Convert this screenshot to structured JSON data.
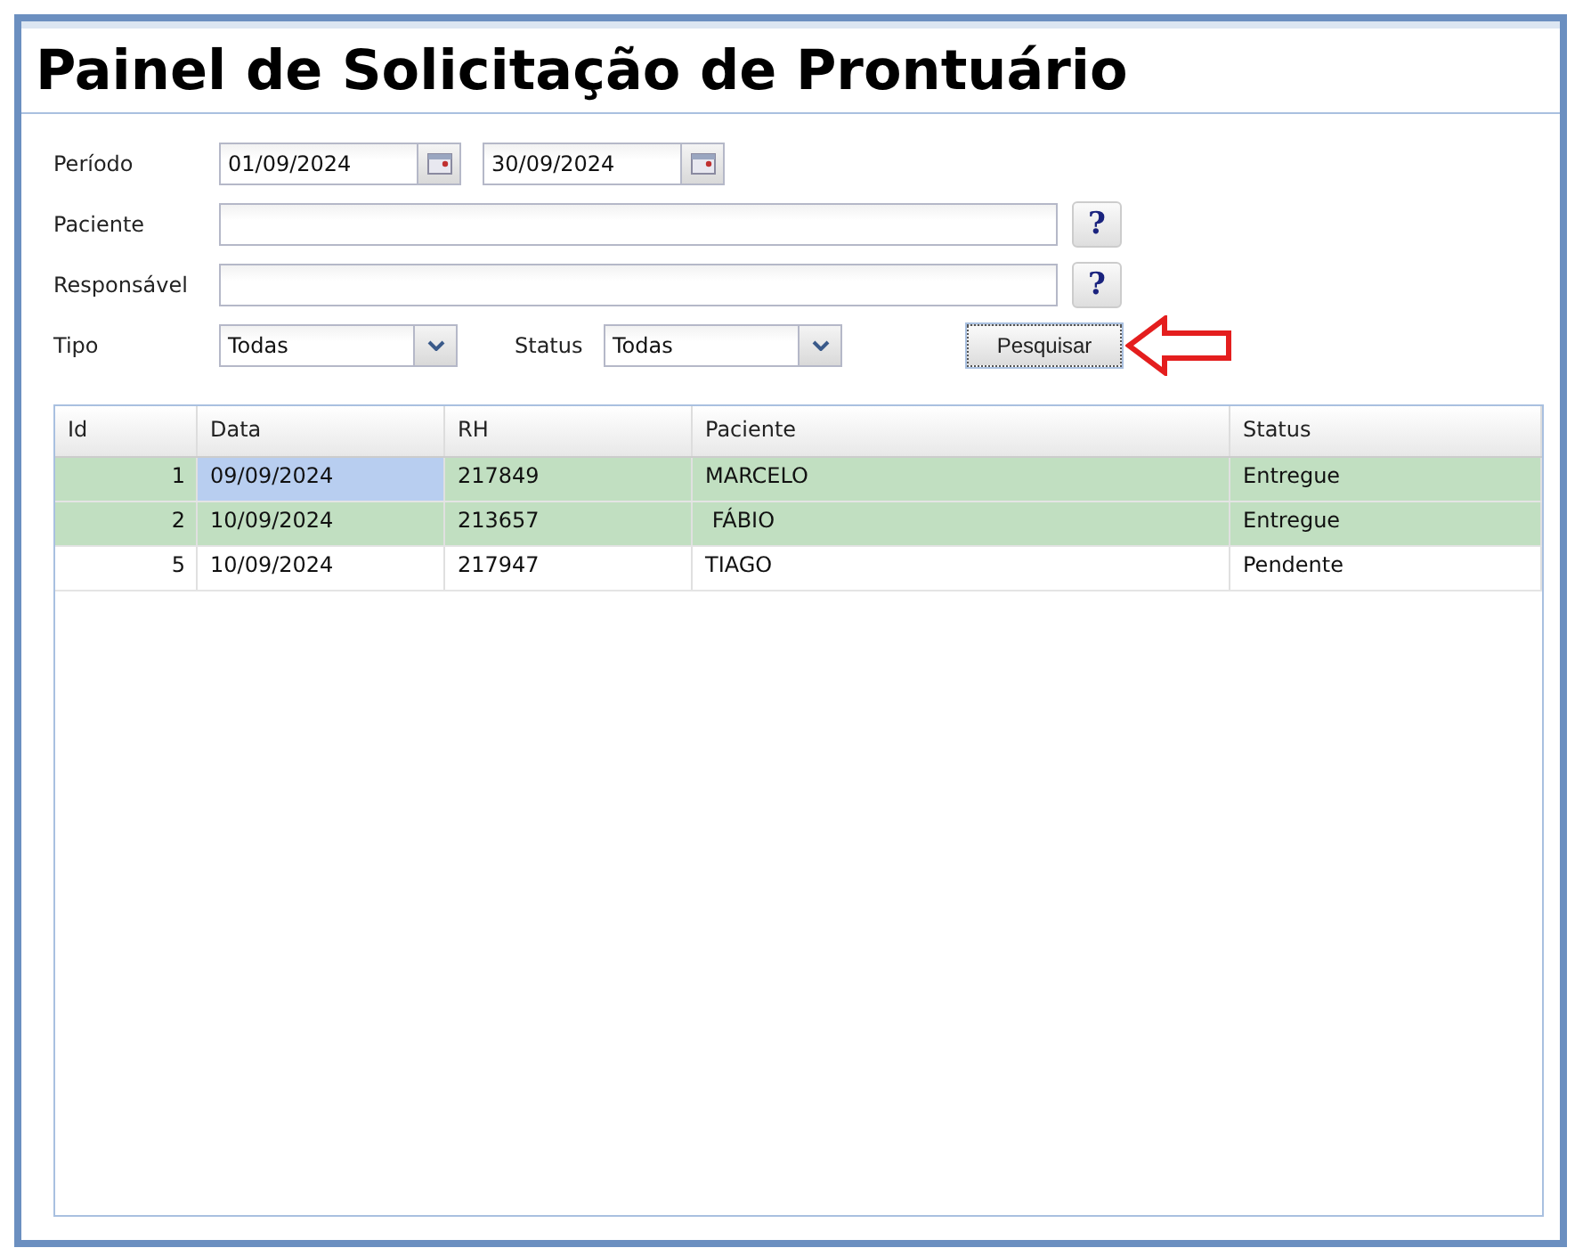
{
  "title": "Painel de Solicitação de Prontuário",
  "filters": {
    "period_label": "Período",
    "date_from": "01/09/2024",
    "date_to": "30/09/2024",
    "patient_label": "Paciente",
    "responsible_label": "Responsável",
    "help_buttons": [
      "?",
      "?"
    ],
    "type_label": "Tipo",
    "type_value": "Todas",
    "status_label": "Status",
    "status_value": "Todas",
    "search_button": "Pesquisar"
  },
  "table": {
    "columns": [
      "Id",
      "Data",
      "RH",
      "Paciente",
      "Status"
    ],
    "rows": [
      {
        "cells": [
          "1",
          "09/09/2024",
          "217849",
          "MARCELO",
          "Entregue"
        ],
        "color": "#c1dfc1",
        "date_selected": true
      },
      {
        "cells": [
          "2",
          "10/09/2024",
          "213657",
          " FÁBIO",
          "Entregue"
        ],
        "color": "#c1dfc1",
        "date_selected": false
      },
      {
        "cells": [
          "5",
          "10/09/2024",
          "217947",
          "TIAGO",
          "Pendente"
        ],
        "color": "#ffffff",
        "date_selected": false
      }
    ]
  }
}
